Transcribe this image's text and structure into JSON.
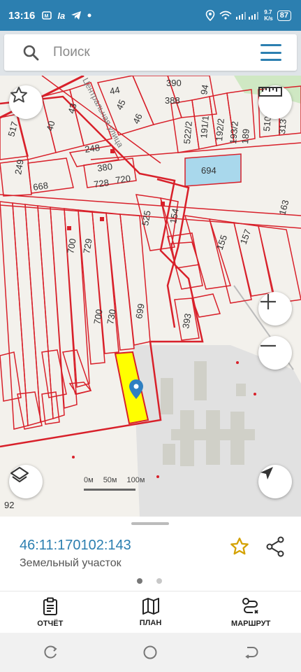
{
  "status": {
    "time": "13:16",
    "left_icons": [
      "sim-icon",
      "ia-icon",
      "telegram-icon",
      "dot-icon"
    ],
    "ia_text": "Ia",
    "speed": "9.7\nK/s",
    "battery": "87"
  },
  "search": {
    "placeholder": "Поиск"
  },
  "map": {
    "parcel_numbers": [
      "44",
      "45",
      "46",
      "390",
      "388",
      "94",
      "43",
      "40",
      "517",
      "248",
      "380",
      "728",
      "720",
      "249",
      "668",
      "522/2",
      "191/1",
      "192/2",
      "193/2",
      "189",
      "510",
      "313",
      "694",
      "163",
      "525",
      "154",
      "155",
      "157",
      "700",
      "729",
      "700",
      "730",
      "699",
      "393"
    ],
    "street_label": "Центральная улица",
    "scale_labels": [
      "0м",
      "50м",
      "100м"
    ],
    "corner_number": "92",
    "colors": {
      "parcel_line": "#d8202a",
      "selected_fill": "#ffff00",
      "marker": "#2f7fc1",
      "water": "#a9d8ec"
    }
  },
  "sheet": {
    "cadastral_number": "46:11:170102:143",
    "property_type": "Земельный участок",
    "page_dots": 2,
    "active_dot": 0
  },
  "tabs": [
    {
      "label": "ОТЧЁТ",
      "icon": "report-icon"
    },
    {
      "label": "ПЛАН",
      "icon": "map-icon"
    },
    {
      "label": "МАРШРУТ",
      "icon": "route-icon"
    }
  ],
  "navbar": [
    "recent-apps-icon",
    "home-icon",
    "back-icon"
  ]
}
